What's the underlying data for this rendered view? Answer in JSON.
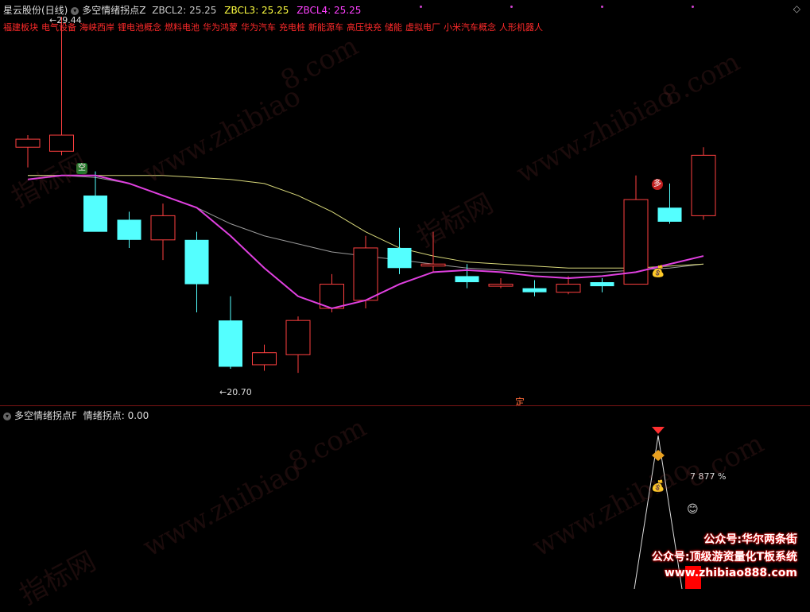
{
  "header": {
    "stock": "星云股份(日线)",
    "indicator": "多空情绪拐点Z",
    "zbcl2": "ZBCL2: 25.25",
    "zbcl3": "ZBCL3: 25.25",
    "zbcl4": "ZBCL4: 25.25",
    "colors": {
      "zbcl2": "#c8c8c8",
      "zbcl3": "#ffff40",
      "zbcl4": "#ff40ff"
    }
  },
  "concepts": [
    "福建板块",
    "电气设备",
    "海峡西岸",
    "锂电池概念",
    "燃料电池",
    "华为鸿蒙",
    "华为汽车",
    "充电桩",
    "新能源车",
    "高压快充",
    "储能",
    "虚拟电厂",
    "小米汽车概念",
    "人形机器人"
  ],
  "price_labels": {
    "high": "29.44",
    "low": "20.70"
  },
  "markers": {
    "kong": "空",
    "duo": "多",
    "ding": "定",
    "moneybag": "💰"
  },
  "sub_header": {
    "indicator": "多空情绪拐点F",
    "value": "情绪拐点: 0.00"
  },
  "sub_labels": {
    "percent": "7 877 %",
    "smile": "😊",
    "moneybag": "💰"
  },
  "watermarks": [
    "指标网",
    "www.zhibiao",
    "8.com",
    "www.zhibiao",
    "8.com",
    "指标网",
    "www.zhibiao",
    "8.com",
    "www.zhibiao",
    "8.com",
    "指标网"
  ],
  "promo": {
    "line1": "公众号:华尔两条街",
    "line2": "公众号:顶级游资量化T板系统",
    "line3": "www.zhibiao888.com"
  },
  "candles": [
    {
      "o": 26.2,
      "h": 26.5,
      "l": 25.7,
      "c": 26.4
    },
    {
      "o": 26.1,
      "h": 29.44,
      "l": 26.0,
      "c": 26.5
    },
    {
      "o": 25.0,
      "h": 25.6,
      "l": 24.3,
      "c": 24.1
    },
    {
      "o": 24.4,
      "h": 24.6,
      "l": 23.7,
      "c": 23.9
    },
    {
      "o": 23.9,
      "h": 24.8,
      "l": 23.4,
      "c": 24.5
    },
    {
      "o": 23.9,
      "h": 24.1,
      "l": 22.1,
      "c": 22.8
    },
    {
      "o": 21.9,
      "h": 22.5,
      "l": 20.7,
      "c": 20.75
    },
    {
      "o": 20.8,
      "h": 21.3,
      "l": 20.65,
      "c": 21.1
    },
    {
      "o": 21.05,
      "h": 22.0,
      "l": 20.6,
      "c": 21.9
    },
    {
      "o": 22.2,
      "h": 23.05,
      "l": 22.1,
      "c": 22.8
    },
    {
      "o": 22.4,
      "h": 24.0,
      "l": 22.2,
      "c": 23.7
    },
    {
      "o": 23.7,
      "h": 24.2,
      "l": 23.05,
      "c": 23.2
    },
    {
      "o": 23.25,
      "h": 24.1,
      "l": 23.1,
      "c": 23.3
    },
    {
      "o": 23.0,
      "h": 23.3,
      "l": 22.7,
      "c": 22.85
    },
    {
      "o": 22.75,
      "h": 22.95,
      "l": 22.7,
      "c": 22.8
    },
    {
      "o": 22.7,
      "h": 22.9,
      "l": 22.5,
      "c": 22.6
    },
    {
      "o": 22.6,
      "h": 23.0,
      "l": 22.55,
      "c": 22.8
    },
    {
      "o": 22.85,
      "h": 22.95,
      "l": 22.6,
      "c": 22.75
    },
    {
      "o": 22.8,
      "h": 25.5,
      "l": 22.8,
      "c": 24.9
    },
    {
      "o": 24.7,
      "h": 25.3,
      "l": 24.3,
      "c": 24.35
    },
    {
      "o": 24.5,
      "h": 26.2,
      "l": 24.4,
      "c": 26.0
    }
  ],
  "ma_magenta": [
    25.4,
    25.5,
    25.5,
    25.3,
    25.0,
    24.7,
    24.0,
    23.2,
    22.5,
    22.2,
    22.4,
    22.8,
    23.1,
    23.15,
    23.1,
    23.0,
    22.95,
    23.0,
    23.1,
    23.3,
    23.5
  ],
  "ma_yellow": [
    25.5,
    25.5,
    25.5,
    25.5,
    25.5,
    25.45,
    25.4,
    25.3,
    25.0,
    24.6,
    24.1,
    23.7,
    23.5,
    23.35,
    23.3,
    23.25,
    23.2,
    23.2,
    23.2,
    23.25,
    23.3
  ],
  "ma_gray": [
    25.5,
    25.5,
    25.45,
    25.3,
    25.0,
    24.7,
    24.3,
    24.0,
    23.8,
    23.6,
    23.5,
    23.4,
    23.3,
    23.2,
    23.15,
    23.1,
    23.1,
    23.1,
    23.15,
    23.2,
    23.3
  ]
}
